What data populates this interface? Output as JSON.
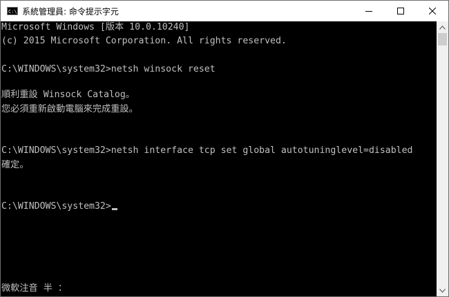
{
  "window": {
    "title": "系統管理員: 命令提示字元",
    "app_icon_text": "C:\\",
    "buttons": {
      "minimize": "minimize-icon",
      "maximize": "maximize-icon",
      "close": "close-icon"
    }
  },
  "console": {
    "lines": [
      "Microsoft Windows [版本 10.0.10240]",
      "(c) 2015 Microsoft Corporation. All rights reserved.",
      "C:\\WINDOWS\\system32>netsh winsock reset",
      "順利重設 Winsock Catalog。",
      "您必須重新啟動電腦來完成重設。",
      "C:\\WINDOWS\\system32>netsh interface tcp set global autotuninglevel=disabled",
      "確定。",
      "C:\\WINDOWS\\system32>"
    ],
    "ime_status": "微軟注音 半 ："
  },
  "colors": {
    "background": "#000000",
    "text": "#c0c0c0",
    "titlebar": "#ffffff",
    "scrollbar": "#f0f0f0"
  }
}
